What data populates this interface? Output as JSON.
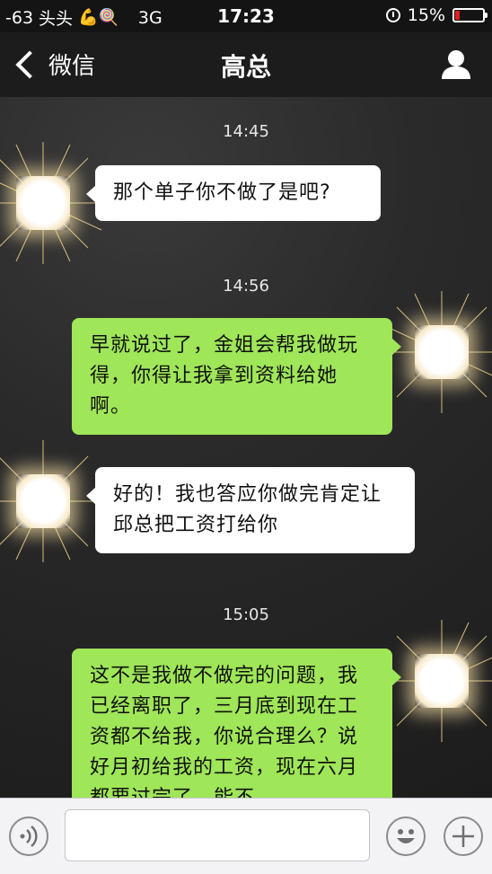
{
  "status_bar": {
    "signal": "-63",
    "carrier": "头头",
    "emoji": "💪🍭",
    "network": "3G",
    "time": "17:23",
    "battery_percent": "15%",
    "battery_level": 0.15,
    "battery_color": "#e02020"
  },
  "nav": {
    "back_label": "微信",
    "title": "高总"
  },
  "chat": {
    "timestamps": [
      "14:45",
      "14:56",
      "15:05"
    ],
    "messages": [
      {
        "side": "received",
        "text": "那个单子你不做了是吧?"
      },
      {
        "side": "sent",
        "text": "早就说过了，金姐会帮我做玩得，你得让我拿到资料给她啊。"
      },
      {
        "side": "received",
        "text": "好的！我也答应你做完肯定让邱总把工资打给你"
      },
      {
        "side": "sent",
        "text": "这不是我做不做完的问题，我已经离职了，三月底到现在工资都不给我，你说合理么？说好月初给我的工资，现在六月都要过完了，能不"
      }
    ]
  },
  "input_bar": {
    "placeholder": ""
  },
  "colors": {
    "sent_bubble": "#9fe658",
    "received_bubble": "#ffffff",
    "nav_background": "#1c1c1c"
  },
  "icons": {
    "back": "chevron-left-icon",
    "profile": "person-icon",
    "voice": "voice-icon",
    "emoji": "smiley-icon",
    "plus": "plus-icon"
  }
}
